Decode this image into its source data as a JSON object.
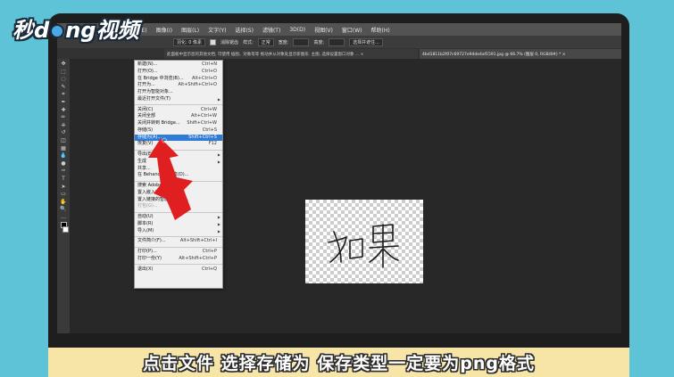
{
  "brand": {
    "prefix": "秒",
    "d": "d",
    "suffix_n": "ng",
    "suffix": "视频"
  },
  "menubar": {
    "items": [
      "文件(F)",
      "编辑(E)",
      "图像(I)",
      "图层(L)",
      "文字(Y)",
      "选择(S)",
      "滤镜(T)",
      "3D(D)",
      "视图(V)",
      "窗口(W)",
      "帮助(H)"
    ]
  },
  "optbar": {
    "feather": "羽化: 0 像素",
    "antialias": "消除锯齿",
    "style": "样式:",
    "style_value": "正常",
    "width": "宽度:",
    "height": "高度:",
    "select_mask": "选择并遮住..."
  },
  "tabs": {
    "hint": "此面板中显示您的其他文档, 可使用 插图、对象等等 拖动并从对象处显示新图形. 主图, 选择设置窗口对象 ... ×",
    "active": "4bd1811b2f07c69727e94de4af1591.jpg @ 66.7% (图层 0, RGB/8#) * ×"
  },
  "toolbar": {
    "icons": [
      "move-icon",
      "marquee-icon",
      "lasso-icon",
      "quick-select-icon",
      "crop-icon",
      "eyedropper-icon",
      "healing-icon",
      "brush-icon",
      "stamp-icon",
      "history-brush-icon",
      "eraser-icon",
      "gradient-icon",
      "blur-icon",
      "dodge-icon",
      "pen-icon",
      "type-icon",
      "path-select-icon",
      "shape-icon",
      "hand-icon",
      "zoom-icon",
      "more-icon"
    ]
  },
  "filemenu": {
    "items": [
      {
        "label": "新建(N)...",
        "shortcut": "Ctrl+N"
      },
      {
        "label": "打开(O)...",
        "shortcut": "Ctrl+O"
      },
      {
        "label": "在 Bridge 中浏览(B)...",
        "shortcut": "Alt+Ctrl+O"
      },
      {
        "label": "打开为...",
        "shortcut": "Alt+Shift+Ctrl+O"
      },
      {
        "label": "打开为智能对象...",
        "shortcut": ""
      },
      {
        "label": "最近打开文件(T)",
        "shortcut": "",
        "submenu": true
      },
      {
        "sep": true
      },
      {
        "label": "关闭(C)",
        "shortcut": "Ctrl+W"
      },
      {
        "label": "关闭全部",
        "shortcut": "Alt+Ctrl+W"
      },
      {
        "label": "关闭并转到 Bridge...",
        "shortcut": "Shift+Ctrl+W"
      },
      {
        "label": "存储(S)",
        "shortcut": "Ctrl+S"
      },
      {
        "label": "存储为(A)...",
        "shortcut": "Shift+Ctrl+S",
        "highlight": true
      },
      {
        "label": "恢复(V)",
        "shortcut": "F12"
      },
      {
        "sep": true
      },
      {
        "label": "导出(E)",
        "shortcut": "",
        "submenu": true
      },
      {
        "label": "生成",
        "shortcut": "",
        "submenu": true
      },
      {
        "label": "共享...",
        "shortcut": ""
      },
      {
        "label": "在 Behance 上共享(D)...",
        "shortcut": ""
      },
      {
        "sep": true
      },
      {
        "label": "搜索 Adobe Stock...",
        "shortcut": ""
      },
      {
        "label": "置入嵌入对象(L)...",
        "shortcut": ""
      },
      {
        "label": "置入链接的智能对象(K)...",
        "shortcut": ""
      },
      {
        "label": "打包(G)...",
        "shortcut": "",
        "disabled": true
      },
      {
        "sep": true
      },
      {
        "label": "自动(U)",
        "shortcut": "",
        "submenu": true
      },
      {
        "label": "脚本(R)",
        "shortcut": "",
        "submenu": true
      },
      {
        "label": "导入(M)",
        "shortcut": "",
        "submenu": true
      },
      {
        "sep": true
      },
      {
        "label": "文件简介(F)...",
        "shortcut": "Alt+Shift+Ctrl+I"
      },
      {
        "sep": true
      },
      {
        "label": "打印(P)...",
        "shortcut": "Ctrl+P"
      },
      {
        "label": "打印一份(Y)",
        "shortcut": "Alt+Shift+Ctrl+P"
      },
      {
        "sep": true
      },
      {
        "label": "退出(X)",
        "shortcut": "Ctrl+Q"
      }
    ]
  },
  "canvas": {
    "handwriting": "如果"
  },
  "subtitle": "点击文件 选择存储为 保存类型一定要为png格式",
  "colors": {
    "highlight": "#2f7cd6",
    "arrow": "#e02020",
    "subtitle_bg": "#f7e5a8",
    "bg": "#5fc3d8"
  }
}
